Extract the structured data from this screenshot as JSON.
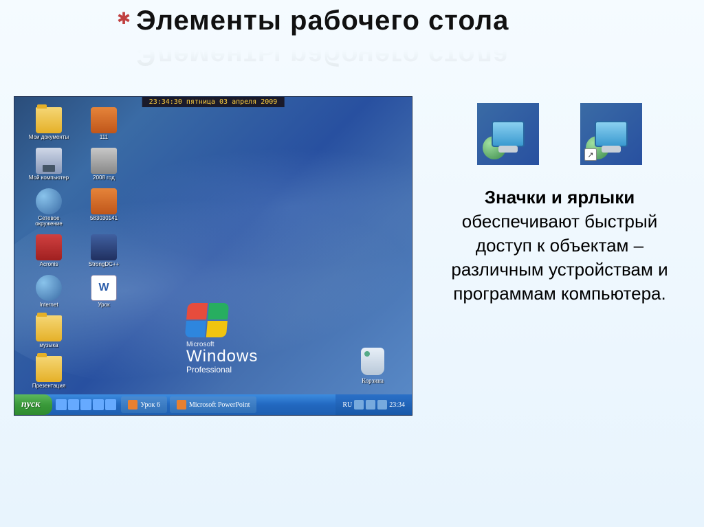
{
  "title": "Элементы рабочего стола",
  "asterisk": "✱",
  "body_text_bold": "Значки и ярлыки",
  "body_text_rest": " обеспечивают быстрый доступ к объектам – различным устройствам и программам компьютера.",
  "desktop": {
    "clock": "23:34:30   пятница 03 апреля 2009",
    "icons": [
      {
        "label": "Мои документы",
        "type": "folder"
      },
      {
        "label": "111",
        "type": "jpg"
      },
      {
        "label": "Мой компьютер",
        "type": "mycomp"
      },
      {
        "label": "2008 год",
        "type": "film"
      },
      {
        "label": "Сетевое окружение",
        "type": "net"
      },
      {
        "label": "583030141",
        "type": "jpg"
      },
      {
        "label": "Acronis",
        "type": "red"
      },
      {
        "label": "StrongDC++",
        "type": "cpp"
      },
      {
        "label": "Internet",
        "type": "net"
      },
      {
        "label": "Урок",
        "type": "word"
      },
      {
        "label": "музыка",
        "type": "folder"
      },
      {
        "label": "",
        "type": ""
      },
      {
        "label": "Презентация",
        "type": "folder"
      },
      {
        "label": "",
        "type": ""
      }
    ],
    "win": {
      "ms": "Microsoft",
      "name": "Windows",
      "edition": "Professional"
    },
    "trash": "Корзина",
    "taskbar": {
      "start": "пуск",
      "tasks": [
        "Урок 6",
        "Microsoft PowerPoint"
      ],
      "tray_lang": "RU",
      "tray_time": "23:34"
    }
  }
}
